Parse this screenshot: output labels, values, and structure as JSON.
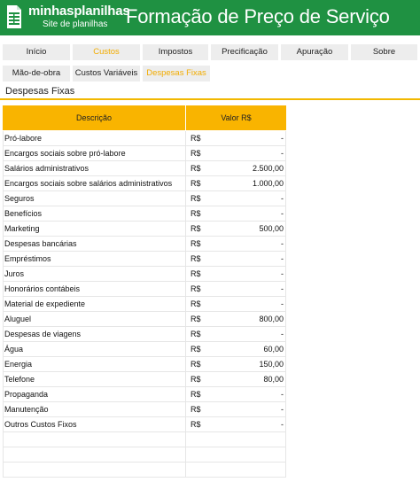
{
  "header": {
    "brand_name": "minhasplanilhas",
    "brand_sub": "Site de planilhas",
    "title": "Formação de Preço de Serviço",
    "logo_icon": "spreadsheet-icon"
  },
  "tabs_row1": [
    {
      "label": "Início",
      "active": false
    },
    {
      "label": "Custos",
      "active": true
    },
    {
      "label": "Impostos",
      "active": false
    },
    {
      "label": "Precificação",
      "active": false
    },
    {
      "label": "Apuração",
      "active": false
    },
    {
      "label": "Sobre",
      "active": false
    }
  ],
  "tabs_row2": [
    {
      "label": "Mão-de-obra",
      "active": false
    },
    {
      "label": "Custos Variáveis",
      "active": false
    },
    {
      "label": "Despesas Fixas",
      "active": true
    }
  ],
  "section": {
    "title": "Despesas Fixas"
  },
  "table": {
    "headers": {
      "description": "Descrição",
      "value": "Valor R$"
    },
    "rows": [
      {
        "desc": "Pró-labore",
        "cur": "R$",
        "amt": "-"
      },
      {
        "desc": "Encargos sociais sobre pró-labore",
        "cur": "R$",
        "amt": "-"
      },
      {
        "desc": "Salários administrativos",
        "cur": "R$",
        "amt": "2.500,00"
      },
      {
        "desc": "Encargos sociais sobre salários administrativos",
        "cur": "R$",
        "amt": "1.000,00"
      },
      {
        "desc": "Seguros",
        "cur": "R$",
        "amt": "-"
      },
      {
        "desc": "Benefícios",
        "cur": "R$",
        "amt": "-"
      },
      {
        "desc": "Marketing",
        "cur": "R$",
        "amt": "500,00"
      },
      {
        "desc": "Despesas bancárias",
        "cur": "R$",
        "amt": "-"
      },
      {
        "desc": "Empréstimos",
        "cur": "R$",
        "amt": "-"
      },
      {
        "desc": "Juros",
        "cur": "R$",
        "amt": "-"
      },
      {
        "desc": "Honorários contábeis",
        "cur": "R$",
        "amt": "-"
      },
      {
        "desc": "Material de expediente",
        "cur": "R$",
        "amt": "-"
      },
      {
        "desc": "Aluguel",
        "cur": "R$",
        "amt": "800,00"
      },
      {
        "desc": "Despesas de viagens",
        "cur": "R$",
        "amt": "-"
      },
      {
        "desc": "Água",
        "cur": "R$",
        "amt": "60,00"
      },
      {
        "desc": "Energia",
        "cur": "R$",
        "amt": "150,00"
      },
      {
        "desc": "Telefone",
        "cur": "R$",
        "amt": "80,00"
      },
      {
        "desc": "Propaganda",
        "cur": "R$",
        "amt": "-"
      },
      {
        "desc": "Manutenção",
        "cur": "R$",
        "amt": "-"
      },
      {
        "desc": "Outros Custos Fixos",
        "cur": "R$",
        "amt": "-"
      },
      {
        "desc": "",
        "cur": "",
        "amt": ""
      },
      {
        "desc": "",
        "cur": "",
        "amt": ""
      },
      {
        "desc": "",
        "cur": "",
        "amt": ""
      }
    ]
  },
  "colors": {
    "header_green": "#1f9142",
    "accent_yellow": "#f9b400",
    "active_tab_text": "#f2ac00"
  }
}
